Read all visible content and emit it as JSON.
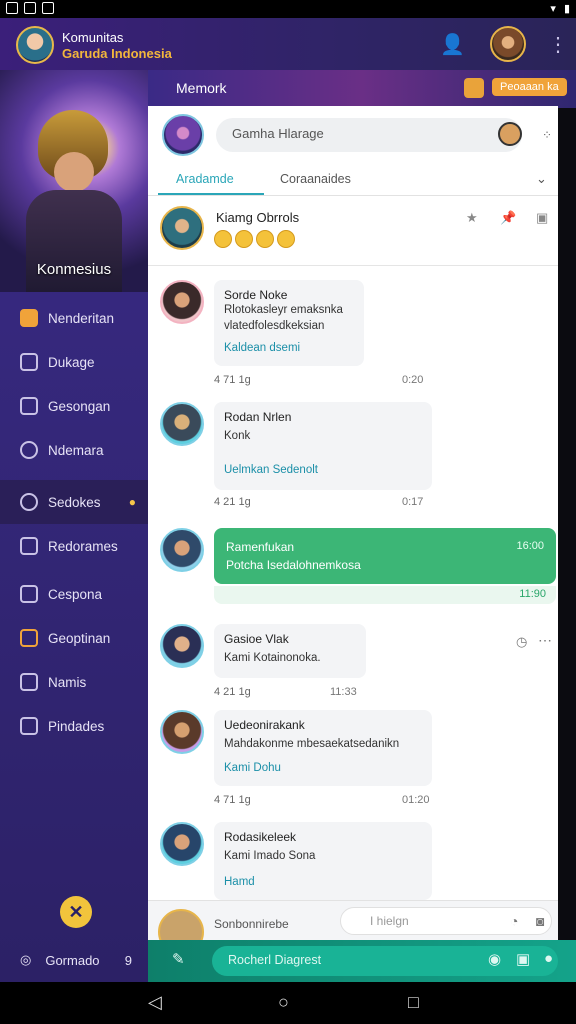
{
  "appbar": {
    "title_line1": "Komunitas",
    "title_line2": "Garuda Indonesia",
    "icons": [
      "person-icon",
      "avatar",
      "more-vert-icon"
    ]
  },
  "sidebar": {
    "hero_title": "Konmesius",
    "items": [
      {
        "label": "Nenderitan",
        "icon": "home-icon"
      },
      {
        "label": "Dukage",
        "icon": "doc-icon"
      },
      {
        "label": "Gesongan",
        "icon": "chat-icon"
      },
      {
        "label": "Ndemara",
        "icon": "bird-icon"
      },
      {
        "label": "Sedokes",
        "icon": "search-icon",
        "active": true
      },
      {
        "label": "Redorames",
        "icon": "list-icon"
      },
      {
        "label": "Cespona",
        "icon": "puzzle-icon"
      },
      {
        "label": "Geoptinan",
        "icon": "box-icon"
      },
      {
        "label": "Namis",
        "icon": "cluster-icon"
      },
      {
        "label": "Pindades",
        "icon": "square-icon"
      }
    ],
    "footer_label": "Gormado",
    "footer_count": "9"
  },
  "banner": {
    "title": "Memork",
    "button_label": "Peoaaan ka"
  },
  "search": {
    "placeholder": "Gamha Hlarage"
  },
  "tabs": [
    {
      "label": "Aradamde",
      "active": true
    },
    {
      "label": "Coraanaides",
      "active": false
    }
  ],
  "pinned": {
    "name": "Kiamg Obrrols"
  },
  "messages": [
    {
      "name": "Sorde Noke",
      "lines": [
        "Rlotokasleyr emaksnka",
        "vlatedfolesdkeksian"
      ],
      "link": "Kaldean dsemi",
      "meta": "4 71 1g",
      "time": "0:20"
    },
    {
      "name": "Rodan Nrlen",
      "lines": [
        "Konk"
      ],
      "link": "Uelmkan Sedenolt",
      "meta": "4 21 1g",
      "time": "0:17"
    },
    {
      "name": "Gasioe Vlak",
      "lines": [
        "Kami  Kotainonoka."
      ],
      "link": "",
      "meta": "4 21 1g",
      "time": "11:33"
    },
    {
      "name": "Uedeonirakank",
      "lines": [
        "Mahdakonme mbesaekatsedanikn"
      ],
      "link": "Kami  Dohu",
      "meta": "4 71 1g",
      "time": "01:20"
    },
    {
      "name": "Rodasikeleek",
      "lines": [
        "Kami  Imado Sona"
      ],
      "link": "Hamd",
      "meta": "",
      "time": ""
    }
  ],
  "green_message": {
    "title": "Ramenfukan",
    "body": "Potcha Isedalohnemkosa",
    "time_top": "16:00",
    "time_bottom": "11:90"
  },
  "composer": {
    "label": "Sonbonnirebe",
    "placeholder": "I hielgn"
  },
  "sendbar": {
    "text": "Rocherl Diagrest"
  }
}
